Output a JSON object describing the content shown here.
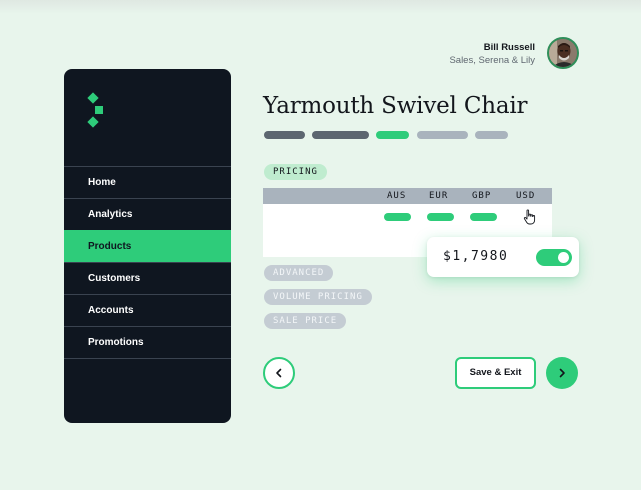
{
  "user": {
    "name": "Bill Russell",
    "org": "Sales, Serena & Lily"
  },
  "sidebar": {
    "items": [
      {
        "label": "Home",
        "active": false
      },
      {
        "label": "Analytics",
        "active": false
      },
      {
        "label": "Products",
        "active": true
      },
      {
        "label": "Customers",
        "active": false
      },
      {
        "label": "Accounts",
        "active": false
      },
      {
        "label": "Promotions",
        "active": false
      }
    ]
  },
  "page": {
    "title": "Yarmouth Swivel Chair"
  },
  "progress": {
    "steps": [
      {
        "state": "complete",
        "color": "#5c6670"
      },
      {
        "state": "complete",
        "color": "#5c6670"
      },
      {
        "state": "current",
        "color": "#2ecc7a"
      },
      {
        "state": "pending",
        "color": "#a9b3bd"
      },
      {
        "state": "pending",
        "color": "#a9b3bd"
      }
    ]
  },
  "pricing": {
    "tab_label": "PRICING",
    "columns": [
      "AUS",
      "EUR",
      "GBP",
      "USD"
    ],
    "sections": [
      "ADVANCED",
      "VOLUME PRICING",
      "SALE PRICE"
    ]
  },
  "popover": {
    "price": "$1,7980",
    "toggle_on": true
  },
  "actions": {
    "save_exit": "Save & Exit"
  },
  "icons": {
    "back": "chevron-left-icon",
    "next": "chevron-right-icon",
    "cursor": "hand-pointer-icon",
    "logo": "brand-logo"
  },
  "colors": {
    "accent": "#2ecc7a",
    "sidebar_bg": "#0f1620",
    "page_bg": "#e8f5ec"
  }
}
